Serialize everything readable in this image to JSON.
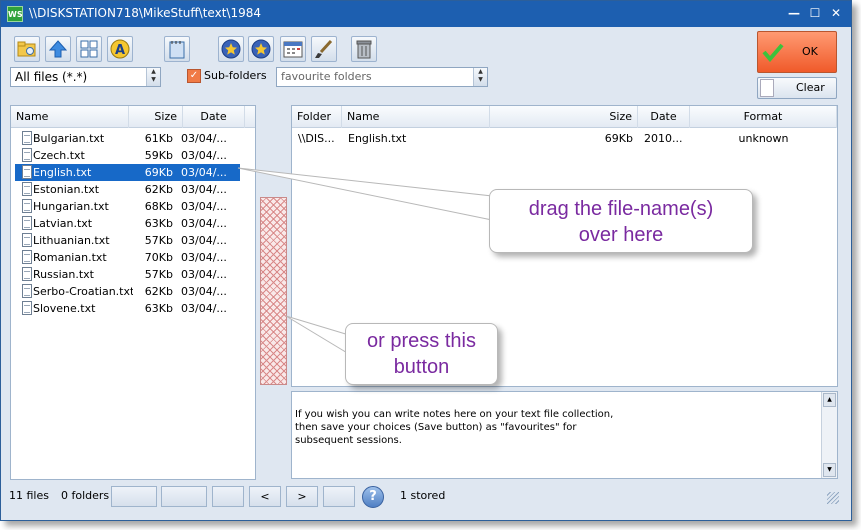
{
  "window": {
    "title": "\\\\DISKSTATION718\\MikeStuff\\text\\1984",
    "app_badge": "WS"
  },
  "toolbar": {
    "file_filter": "All files (*.*)",
    "subfolders_label": "Sub-folders",
    "subfolders_checked": true,
    "favourites_placeholder": "favourite folders",
    "ok_label": "OK",
    "clear_label": "Clear"
  },
  "left_list": {
    "columns": [
      "Name",
      "Size",
      "Date"
    ],
    "rows": [
      {
        "name": "Bulgarian.txt",
        "size": "61Kb",
        "date": "03/04/..."
      },
      {
        "name": "Czech.txt",
        "size": "59Kb",
        "date": "03/04/..."
      },
      {
        "name": "English.txt",
        "size": "69Kb",
        "date": "03/04/...",
        "selected": true
      },
      {
        "name": "Estonian.txt",
        "size": "62Kb",
        "date": "03/04/..."
      },
      {
        "name": "Hungarian.txt",
        "size": "68Kb",
        "date": "03/04/..."
      },
      {
        "name": "Latvian.txt",
        "size": "63Kb",
        "date": "03/04/..."
      },
      {
        "name": "Lithuanian.txt",
        "size": "57Kb",
        "date": "03/04/..."
      },
      {
        "name": "Romanian.txt",
        "size": "70Kb",
        "date": "03/04/..."
      },
      {
        "name": "Russian.txt",
        "size": "57Kb",
        "date": "03/04/..."
      },
      {
        "name": "Serbo-Croatian.txt",
        "size": "62Kb",
        "date": "03/04/..."
      },
      {
        "name": "Slovene.txt",
        "size": "63Kb",
        "date": "03/04/..."
      }
    ]
  },
  "right_list": {
    "columns": [
      "Folder",
      "Name",
      "Size",
      "Date",
      "Format"
    ],
    "rows": [
      {
        "folder": "\\\\DIS...",
        "name": "English.txt",
        "size": "69Kb",
        "date": "2010...",
        "format": "unknown"
      }
    ]
  },
  "callouts": {
    "drag": "drag the file-name(s)\nover here",
    "press": "or press this\nbutton"
  },
  "notes": "If you wish you can write notes here on your text file collection,\nthen save your choices (Save button) as \"favourites\" for\nsubsequent sessions.",
  "status": {
    "files": "11 files",
    "folders": "0 folders",
    "prev": "<",
    "next": ">",
    "help": "?",
    "stored": "1 stored"
  }
}
